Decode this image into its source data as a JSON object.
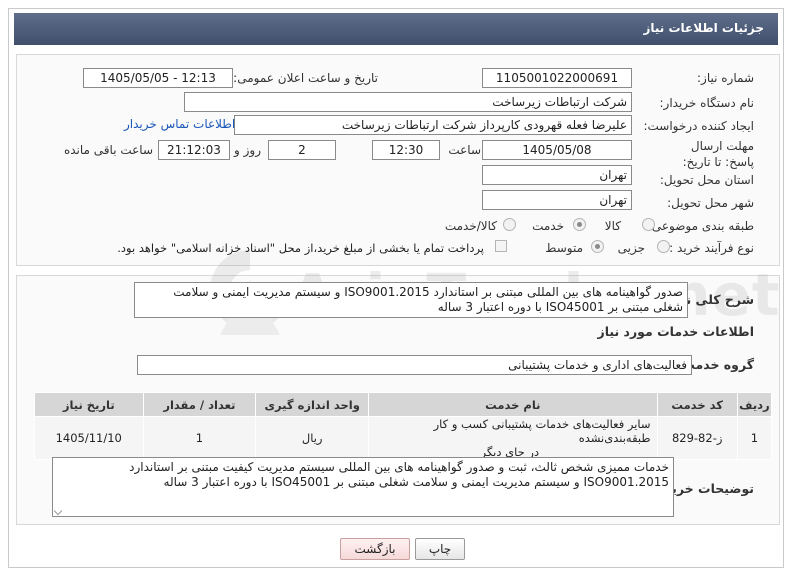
{
  "header": {
    "title": "جزئیات اطلاعات نیاز"
  },
  "form": {
    "need_number": {
      "label": "شماره نیاز:",
      "value": "1105001022000691"
    },
    "announce_datetime": {
      "label": "تاریخ و ساعت اعلان عمومی:",
      "value": "1405/05/05 - 12:13"
    },
    "buyer_org": {
      "label": "نام دستگاه خریدار:",
      "value": "شرکت ارتباطات زیرساخت"
    },
    "requester": {
      "label": "ایجاد کننده درخواست:",
      "value": "علیرضا فعله قهرودی کارپرداز شرکت ارتباطات زیرساخت",
      "contact_link": "اطلاعات تماس خریدار"
    },
    "deadline": {
      "label": "مهلت ارسال پاسخ: تا تاریخ:",
      "date": "1405/05/08",
      "time_label": "ساعت",
      "time": "12:30",
      "days": "2",
      "days_label": "روز و",
      "remaining": "21:12:03",
      "remaining_label": "ساعت باقی مانده"
    },
    "delivery_province": {
      "label": "استان محل تحویل:",
      "value": "تهران"
    },
    "delivery_city": {
      "label": "شهر محل تحویل:",
      "value": "تهران"
    },
    "category": {
      "label": "طبقه بندی موضوعی:",
      "options": [
        "کالا",
        "خدمت",
        "کالا/خدمت"
      ],
      "selected": "خدمت"
    },
    "purchase_type": {
      "label": "نوع فرآیند خرید :",
      "options": [
        "جزیی",
        "متوسط"
      ],
      "selected": "متوسط",
      "payment_note": "پرداخت تمام یا بخشی از مبلغ خرید،از محل \"اسناد خزانه اسلامی\" خواهد بود."
    }
  },
  "summary": {
    "label": "شرح کلی نیاز:",
    "text_line1": "صدور گواهینامه های بین المللی مبتنی بر استاندارد ISO9001.2015 و سیستم مدیریت ایمنی و سلامت",
    "text_line2": "شغلی مبتنی بر ISO45001 با دوره اعتبار 3 ساله"
  },
  "services_section": {
    "title": "اطلاعات خدمات مورد نیاز",
    "group_label": "گروه خدمت:",
    "group_value": "فعالیت‌های اداری و خدمات پشتیبانی"
  },
  "table": {
    "headers": [
      "ردیف",
      "کد خدمت",
      "نام خدمت",
      "واحد اندازه گیری",
      "تعداد / مقدار",
      "تاریخ نیاز"
    ],
    "rows": [
      {
        "row": "1",
        "code": "ز-82-829",
        "name_line1": "سایر فعالیت‌های خدمات پشتیبانی کسب و کار طبقه‌بندی‌نشده",
        "name_line2": "در جای دیگر",
        "unit": "ریال",
        "qty": "1",
        "date": "1405/11/10"
      }
    ]
  },
  "buyer_notes": {
    "label": "توضیحات خریدار:",
    "line1": "خدمات ممیزی شخص ثالث، ثبت و صدور گواهینامه های بین المللی سیستم مدیریت کیفیت مبتنی بر استاندارد",
    "line2": "ISO9001.2015 و سیستم مدیریت ایمنی و سلامت شغلی مبتنی بر ISO45001 با دوره اعتبار 3 ساله"
  },
  "buttons": {
    "print": "چاپ",
    "back": "بازگشت"
  },
  "watermark": {
    "text": "AriaTender.net"
  },
  "colors": {
    "header_bg": "#4b5b78",
    "link": "#1a56b8",
    "back_button": "#f6d9d9"
  }
}
